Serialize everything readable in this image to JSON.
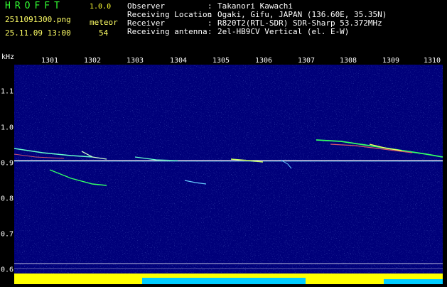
{
  "header": {
    "app_title": "HROFFT",
    "version": "1.0.0",
    "filename": "2511091300.png",
    "datetime": "25.11.09 13:00",
    "detection_label": "meteor",
    "detection_count": "54"
  },
  "info": [
    {
      "key": "Observer",
      "value": "Takanori Kawachi"
    },
    {
      "key": "Receiving Location",
      "value": "Ogaki, Gifu, JAPAN (136.60E, 35.35N)"
    },
    {
      "key": "Receiver",
      "value": "R820T2(RTL-SDR) SDR-Sharp 53.372MHz"
    },
    {
      "key": "Receiving antenna",
      "value": "2el-HB9CV Vertical (el. E-W)"
    }
  ],
  "axis": {
    "y_unit": "kHz",
    "x_ticks": [
      "1301",
      "1302",
      "1303",
      "1304",
      "1305",
      "1306",
      "1307",
      "1308",
      "1309",
      "1310"
    ],
    "y_ticks": [
      "1.1",
      "1.0",
      "0.9",
      "0.8",
      "0.7",
      "0.6"
    ]
  },
  "colors": {
    "background": "#000000",
    "plot_background": "#00007a",
    "carrier_line": "#ffffff",
    "meteor_trail": "#33ff66",
    "power_bar": "#ffff00",
    "power_base": "#00ccff"
  }
}
